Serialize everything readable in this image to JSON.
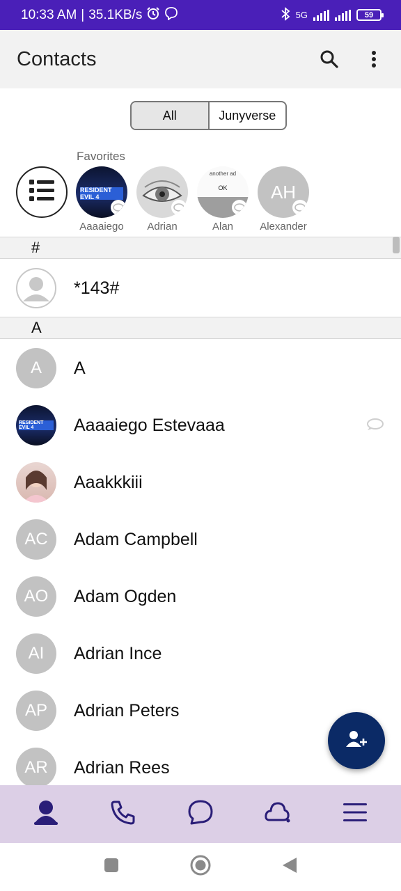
{
  "status_bar": {
    "time": "10:33 AM",
    "speed": "35.1KB/s",
    "network": "5G",
    "battery": "59"
  },
  "app_bar": {
    "title": "Contacts"
  },
  "tabs": [
    {
      "label": "All",
      "active": true
    },
    {
      "label": "Junyverse",
      "active": false
    }
  ],
  "favorites": {
    "label": "Favorites",
    "items": [
      {
        "name": "Aaaaiego",
        "avatar_type": "photo-game",
        "photo_text": "RESIDENT EVIL 4"
      },
      {
        "name": "Adrian",
        "avatar_type": "photo-eye"
      },
      {
        "name": "Alan",
        "avatar_type": "photo-dialog",
        "photo_text": "another ad",
        "photo_button": "OK"
      },
      {
        "name": "Alexander",
        "avatar_type": "initials",
        "initials": "AH"
      }
    ]
  },
  "sections": [
    {
      "letter": "#"
    },
    {
      "letter": "A"
    }
  ],
  "contacts_hash": [
    {
      "name": "*143#",
      "avatar_type": "placeholder"
    }
  ],
  "contacts_a": [
    {
      "name": "A",
      "initials": "A",
      "avatar_type": "initials"
    },
    {
      "name": "Aaaaiego Estevaaa",
      "avatar_type": "photo-game",
      "photo_text": "RESIDENT EVIL 4",
      "viber": true
    },
    {
      "name": "Aaakkkiii",
      "avatar_type": "photo-person"
    },
    {
      "name": "Adam Campbell",
      "initials": "AC",
      "avatar_type": "initials"
    },
    {
      "name": "Adam Ogden",
      "initials": "AO",
      "avatar_type": "initials"
    },
    {
      "name": "Adrian Ince",
      "initials": "AI",
      "avatar_type": "initials"
    },
    {
      "name": "Adrian Peters",
      "initials": "AP",
      "avatar_type": "initials"
    },
    {
      "name": "Adrian Rees",
      "initials": "AR",
      "avatar_type": "initials"
    }
  ],
  "icons": {
    "search": "search-icon",
    "more": "more-vert-icon",
    "favorites_list": "list-icon",
    "fab": "add-contact-icon",
    "nav": [
      "contacts-icon",
      "phone-icon",
      "chat-icon",
      "viber-icon",
      "menu-icon"
    ],
    "system": [
      "recents-icon",
      "home-icon",
      "back-icon"
    ]
  },
  "colors": {
    "status_bar": "#4a1fb8",
    "fab": "#0b2a66",
    "bottom_nav": "#dccfe6",
    "nav_icon": "#2a1e78",
    "avatar_bg": "#c2c2c2"
  }
}
